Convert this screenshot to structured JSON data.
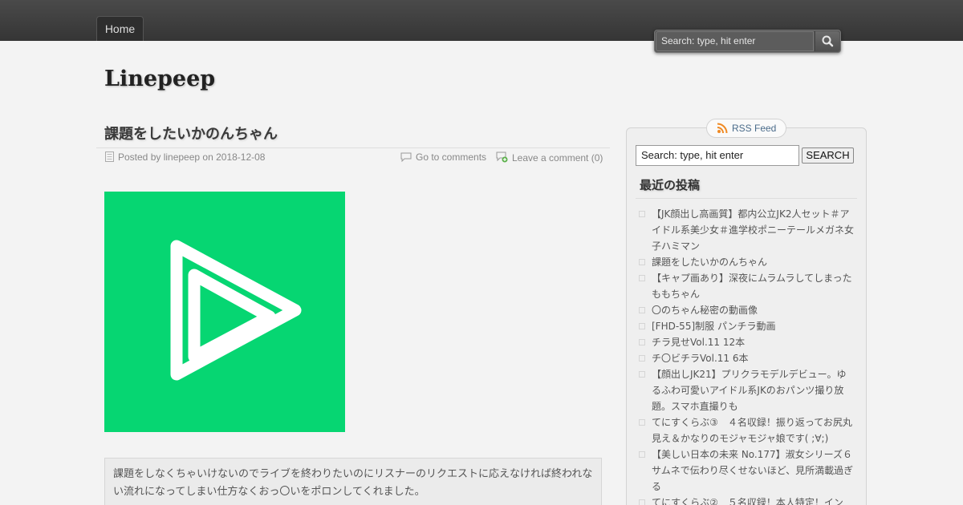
{
  "nav": {
    "home_label": "Home"
  },
  "top_search": {
    "placeholder": "Search: type, hit enter"
  },
  "site": {
    "title": "Linepeep"
  },
  "post": {
    "title": "課題をしたいかのんちゃん",
    "meta_posted": "Posted by linepeep on 2018-12-08",
    "go_to_comments": "Go to comments",
    "leave_comment": "Leave a comment (0)",
    "excerpt": "課題をしなくちゃいけないのでライブを終わりたいのにリスナーのリクエストに応えなければ終われない流れになってしまい仕方なくおっ〇いをポロンしてくれました。",
    "thumbnail_color": "#06d672"
  },
  "sidebar": {
    "rss_label": "RSS Feed",
    "search_value": "Search: type, hit enter",
    "search_button": "SEARCH",
    "recent_title": "最近の投稿",
    "recent_posts": [
      "【JK顔出し高画質】都内公立JK2人セット＃アイドル系美少女＃進学校ポニーテールメガネ女子ハミマン",
      "課題をしたいかのんちゃん",
      "【キャプ画あり】深夜にムラムラしてしまったももちゃん",
      "〇のちゃん秘密の動画像",
      "[FHD-55]制服 パンチラ動画",
      "チラ見せVol.11 12本",
      "チ〇ビチラVol.11 6本",
      "【顔出しJK21】プリクラモデルデビュー。ゆるふわ可愛いアイドル系JKのおパンツ撮り放題。スマホ直撮りも",
      "てにすくらぶ③　４名収録！振り返ってお尻丸見え＆かなりのモジャモジャ娘です( ;∀;)",
      "【美しい日本の未来 No.177】淑女シリーズ６　サムネで伝わり尽くせないほど、見所満載過ぎる",
      "てにすくらぶ②　５名収録！本人特定！イン"
    ]
  }
}
